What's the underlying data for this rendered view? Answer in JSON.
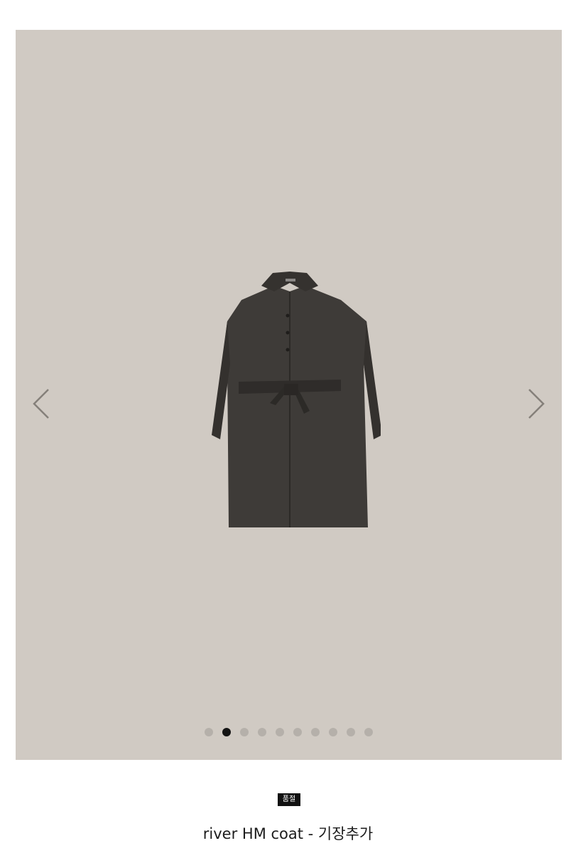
{
  "gallery": {
    "background_color": "#d0cac3",
    "image_subject": "coat-image",
    "prev_icon": "chevron-left-icon",
    "next_icon": "chevron-right-icon",
    "slide_count": 10,
    "active_slide": 2
  },
  "product": {
    "badge": "품절",
    "title": "river HM coat - 기장추가"
  }
}
